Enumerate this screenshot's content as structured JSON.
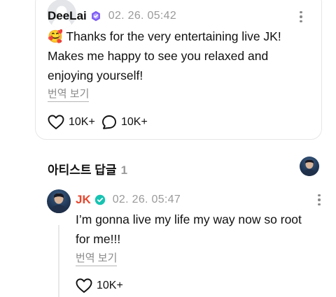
{
  "comment": {
    "username": "DeeLai",
    "timestamp": "02. 26. 05:42",
    "emoji": "🥰",
    "text_line1": "Thanks for the very entertaining live JK!",
    "text_line2": "Makes me happy to see you relaxed and",
    "text_line3": "enjoying yourself!",
    "translate_label": "번역 보기",
    "likes": "10K+",
    "replies": "10K+"
  },
  "artist_reply_section": {
    "title": "아티스트 답글",
    "count": "1"
  },
  "reply": {
    "username": "JK",
    "timestamp": "02. 26. 05:47",
    "text_line1": "I’m gonna live my life my way now so root",
    "text_line2": "for me!!!",
    "translate_label": "번역 보기",
    "likes": "10K+"
  },
  "colors": {
    "verified_purple": "#7d5cf5",
    "verified_teal": "#17c3b2",
    "artist_name": "#e8462e",
    "muted": "#9a9a9a"
  }
}
